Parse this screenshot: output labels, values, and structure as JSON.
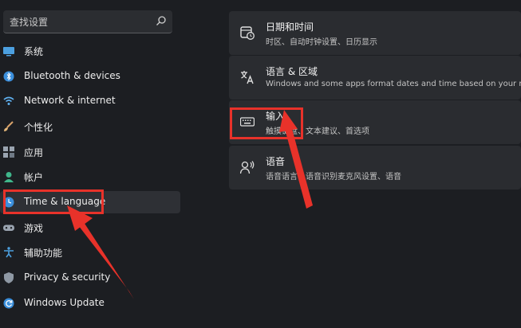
{
  "search": {
    "placeholder": "查找设置"
  },
  "sidebar": {
    "items": [
      {
        "label": "系统",
        "icon": "system-icon"
      },
      {
        "label": "Bluetooth & devices",
        "icon": "bluetooth-icon"
      },
      {
        "label": "Network & internet",
        "icon": "wifi-icon"
      },
      {
        "label": "个性化",
        "icon": "brush-icon"
      },
      {
        "label": "应用",
        "icon": "apps-icon"
      },
      {
        "label": "帐户",
        "icon": "account-icon"
      },
      {
        "label": "Time & language",
        "icon": "globe-clock-icon",
        "active": true
      },
      {
        "label": "游戏",
        "icon": "gamepad-icon"
      },
      {
        "label": "辅助功能",
        "icon": "accessibility-icon"
      },
      {
        "label": "Privacy & security",
        "icon": "shield-icon"
      },
      {
        "label": "Windows Update",
        "icon": "update-icon"
      }
    ]
  },
  "main": {
    "cards": [
      {
        "title": "日期和时间",
        "subtitle": "时区、自动时钟设置、日历显示",
        "icon": "date-time-icon"
      },
      {
        "title": "语言 & 区域",
        "subtitle": "Windows and some apps format dates and time based on your region",
        "icon": "language-region-icon"
      },
      {
        "title": "输入",
        "subtitle": "触摸键盘、文本建议、首选项",
        "icon": "keyboard-icon"
      },
      {
        "title": "语音",
        "subtitle": "语音语言、语音识别麦克风设置、语音",
        "icon": "speech-icon"
      }
    ]
  },
  "colors": {
    "highlight": "#e8322a",
    "accent": "#4ca0e0",
    "background": "#1c1e22",
    "card": "#2a2c30"
  }
}
